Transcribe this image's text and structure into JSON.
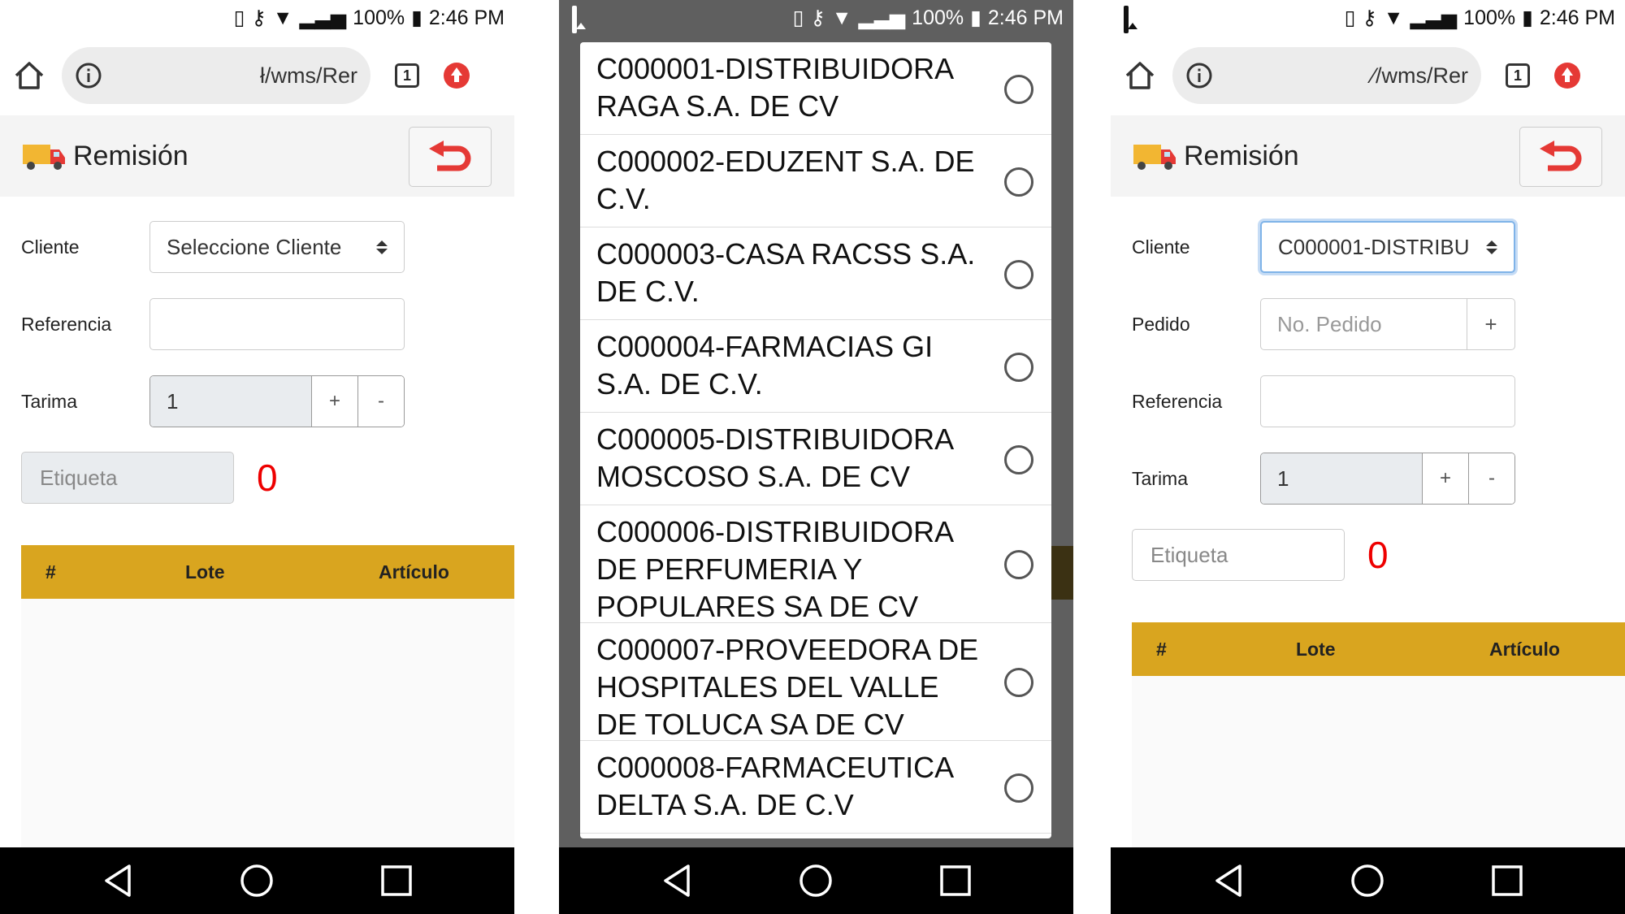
{
  "status": {
    "battery": "100%",
    "time": "2:46 PM"
  },
  "browser": {
    "url1": "ł/wms/Rer",
    "url3": "⁄/wms/Rer",
    "tab_count": "1"
  },
  "page": {
    "title": "Remisión"
  },
  "form": {
    "cliente_label": "Cliente",
    "cliente_placeholder": "Seleccione Cliente",
    "cliente_selected": "C000001-DISTRIBU",
    "pedido_label": "Pedido",
    "pedido_placeholder": "No. Pedido",
    "referencia_label": "Referencia",
    "tarima_label": "Tarima",
    "tarima_value": "1",
    "plus": "+",
    "minus": "-",
    "etiqueta_placeholder": "Etiqueta",
    "count": "0"
  },
  "table": {
    "columns": [
      "#",
      "Lote",
      "Artículo"
    ]
  },
  "dialog": {
    "options": [
      "C000001-DISTRIBUIDORA RAGA S.A. DE CV",
      "C000002-EDUZENT S.A. DE C.V.",
      "C000003-CASA RACSS S.A. DE C.V.",
      "C000004-FARMACIAS GI S.A. DE C.V.",
      "C000005-DISTRIBUIDORA MOSCOSO S.A. DE CV",
      "C000006-DISTRIBUIDORA DE PERFUMERIA Y POPULARES SA DE CV",
      "C000007-PROVEEDORA DE HOSPITALES DEL VALLE DE TOLUCA SA DE CV",
      "C000008-FARMACEUTICA DELTA S.A. DE C.V"
    ]
  },
  "colors": {
    "accent": "#d9a51f",
    "count": "#ee0000",
    "back_arrow": "#e53935"
  }
}
